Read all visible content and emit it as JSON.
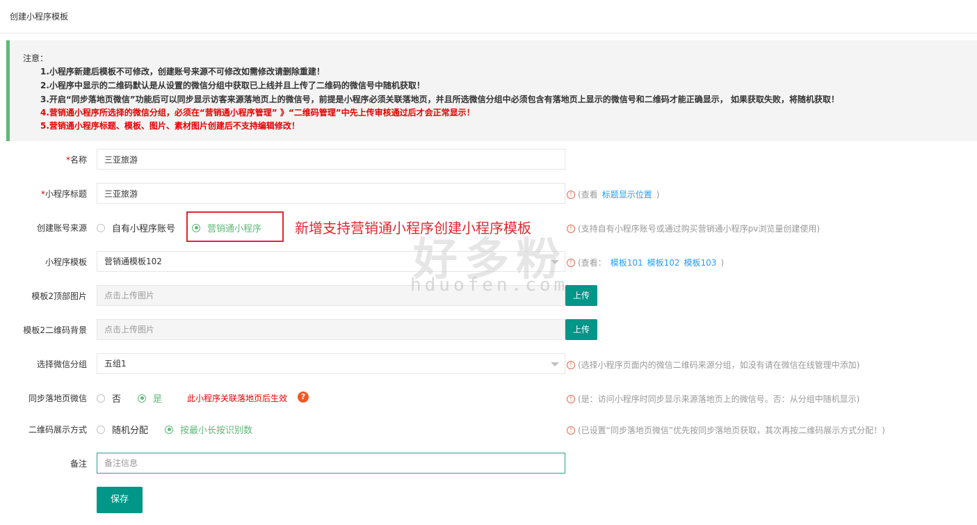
{
  "page": {
    "title": "创建小程序模板"
  },
  "notice": {
    "heading": "注意：",
    "lines": [
      "1.小程序新建后模板不可修改，创建账号来源不可修改如需修改请删除重建！",
      "2.小程序中显示的二维码默认是从设置的微信分组中获取已上线并且上传了二维码的微信号中随机获取！",
      "3.开启“同步落地页微信”功能后可以同步显示访客来源落地页上的微信号，前提是小程序必须关联落地页，并且所选微信分组中必须包含有落地页上显示的微信号和二维码才能正确显示， 如果获取失败，将随机获取！",
      "4.营销通小程序所选择的微信分组，必须在“营销通小程序管理” 》“二维码管理”中先上传审核通过后才会正常显示！",
      "5.营销通小程序标题、模板、图片、素材图片创建后不支持编辑修改！"
    ]
  },
  "form": {
    "name": {
      "required": "*",
      "label": "名称",
      "value": "三亚旅游"
    },
    "title": {
      "required": "*",
      "label": "小程序标题",
      "value": "三亚旅游",
      "hint_prefix": "(查看",
      "hint_link": "标题显示位置",
      "hint_suffix": ")"
    },
    "source": {
      "label": "创建账号来源",
      "options": [
        "自有小程序账号",
        "营销通小程序"
      ],
      "selected": "营销通小程序",
      "hint": "(支持自有小程序账号或通过购买营销通小程序pv浏览量创建使用)"
    },
    "template": {
      "label": "小程序模板",
      "value": "营销通模板102",
      "hint_prefix": "(查看：",
      "links": [
        "模板101",
        "模板102",
        "模板103"
      ],
      "hint_suffix": ")"
    },
    "top_image": {
      "label": "模板2顶部图片",
      "placeholder": "点击上传图片",
      "button": "上传"
    },
    "qr_bg": {
      "label": "模板2二维码背景",
      "placeholder": "点击上传图片",
      "button": "上传"
    },
    "wechat_group": {
      "label": "选择微信分组",
      "value": "五组1",
      "hint": "(选择小程序页面内的微信二维码来源分组，如没有请在微信在线管理中添加)"
    },
    "sync": {
      "label": "同步落地页微信",
      "options": [
        "否",
        "是"
      ],
      "selected": "是",
      "note": "此小程序关联落地页后生效",
      "hint": "(是：访问小程序时同步显示来源落地页上的微信号。否：从分组中随机显示)"
    },
    "qr_mode": {
      "label": "二维码展示方式",
      "options": [
        "随机分配",
        "按最小长按识别数"
      ],
      "selected": "按最小长按识别数",
      "hint": "(已设置“同步落地页微信”优先按同步落地页获取，其次再按二维码展示方式分配！)"
    },
    "remark": {
      "label": "备注",
      "placeholder": "备注信息"
    },
    "save": "保存"
  },
  "annotation": "新增支持营销通小程序创建小程序模板",
  "watermark": {
    "main": "好多粉",
    "sub": "hduofen.com"
  },
  "colors": {
    "accent": "#009688",
    "radio_on": "#5fb878",
    "warning": "#e60000",
    "link": "#1e9fff",
    "notice_bar": "#5fb878"
  },
  "icons": {
    "hint": "info-circle-icon",
    "question": "question-circle-icon",
    "dropdown": "chevron-down-icon"
  }
}
